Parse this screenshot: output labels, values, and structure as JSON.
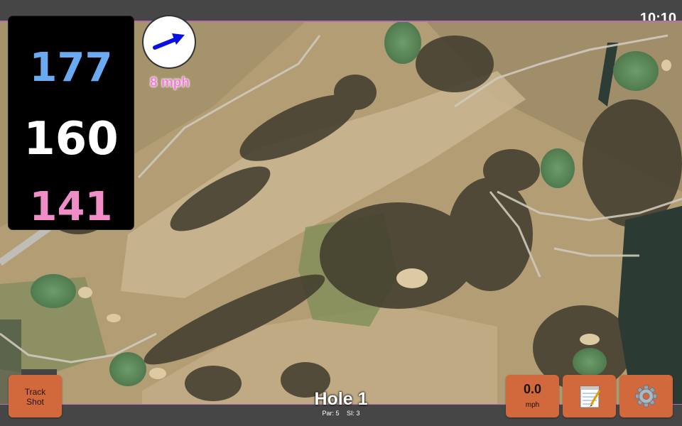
{
  "status_bar": {
    "clock": "10:10"
  },
  "yardages": {
    "back": "177",
    "middle": "160",
    "front": "141",
    "colors": {
      "back": "#6aaaf0",
      "middle": "#ffffff",
      "front": "#f08cc8"
    }
  },
  "wind": {
    "indicator_icon": "wind-arrow-icon",
    "speed_label": "8 mph"
  },
  "buttons": {
    "track_shot_line1": "Track",
    "track_shot_line2": "Shot",
    "wind_speed_value": "0.0",
    "wind_speed_unit": "mph",
    "notes_icon": "notepad-icon",
    "settings_icon": "gear-icon",
    "accent_color": "#d2693c"
  },
  "hole": {
    "title": "Hole 1",
    "par": "Par: 5",
    "stroke_index": "SI: 3"
  },
  "map": {
    "type": "satellite-aerial-golf-course"
  }
}
